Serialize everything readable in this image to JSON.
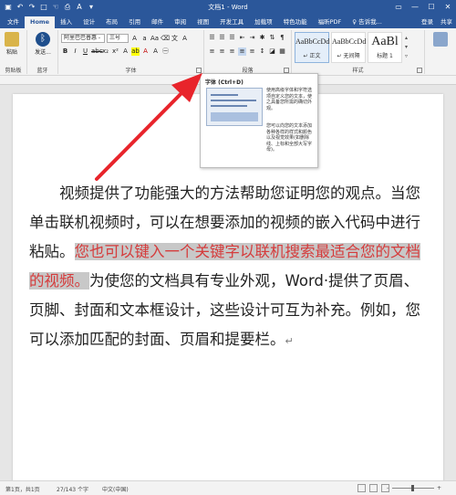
{
  "window": {
    "title": "文档1 - Word"
  },
  "tabs": [
    {
      "label": "文件"
    },
    {
      "label": "Home"
    },
    {
      "label": "插入"
    },
    {
      "label": "设计"
    },
    {
      "label": "布局"
    },
    {
      "label": "引用"
    },
    {
      "label": "邮件"
    },
    {
      "label": "审阅"
    },
    {
      "label": "视图"
    },
    {
      "label": "开发工具"
    },
    {
      "label": "加载项"
    },
    {
      "label": "特色功能"
    },
    {
      "label": "福昕PDF"
    },
    {
      "label": "♀ 告诉我..."
    }
  ],
  "tab_right": {
    "login": "登录",
    "share": "共享"
  },
  "ribbon": {
    "paste_label": "粘贴",
    "send_label": "发送...",
    "font_name": "阿里巴巴普惠 -",
    "font_size": "三号",
    "group_clipboard": "剪贴板",
    "group_bluetooth": "蓝牙",
    "group_font": "字体",
    "group_paragraph": "段落",
    "group_styles": "样式",
    "styles": [
      {
        "sample": "AaBbCcDd",
        "name": "↵ 正文"
      },
      {
        "sample": "AaBbCcDd",
        "name": "↵ 无间隔"
      },
      {
        "sample": "AaBl",
        "name": "标题 1"
      }
    ],
    "colors": {
      "accent": "#2b579a",
      "font_color_red": "#c00000",
      "highlight_yellow": "#ffff00"
    }
  },
  "tooltip": {
    "title": "字体 (Ctrl+D)",
    "desc1": "使用高级字体和字符选项自定义您的文本，使之具备您所需的确切外观。",
    "desc2": "您可以向您的文本添加各种各样的样式和颜色以及视觉效果(如删除线、上标和全部大写字母)。"
  },
  "document": {
    "text_before": "视频提供了功能强大的方法帮助您证明您的观点。当您单击联机视频时，可以在想要添加的视频的嵌入代码中进行粘贴。",
    "text_highlight": "您也可以键入一个关键字以联机搜索最适合您的文档的视频。",
    "text_after": "为使您的文档具有专业外观，Word·提供了页眉、页脚、封面和文本框设计，这些设计可互为补充。例如，您可以添加匹配的封面、页眉和提要栏。",
    "paragraph_mark": "↵",
    "highlight_text_color": "#d53c3c",
    "highlight_bg_color": "#c8c8c8"
  },
  "statusbar": {
    "page": "第1页，共1页",
    "words": "27/143 个字",
    "language": "中文(中国)",
    "zoom": "-",
    "zoom_plus": "+"
  }
}
